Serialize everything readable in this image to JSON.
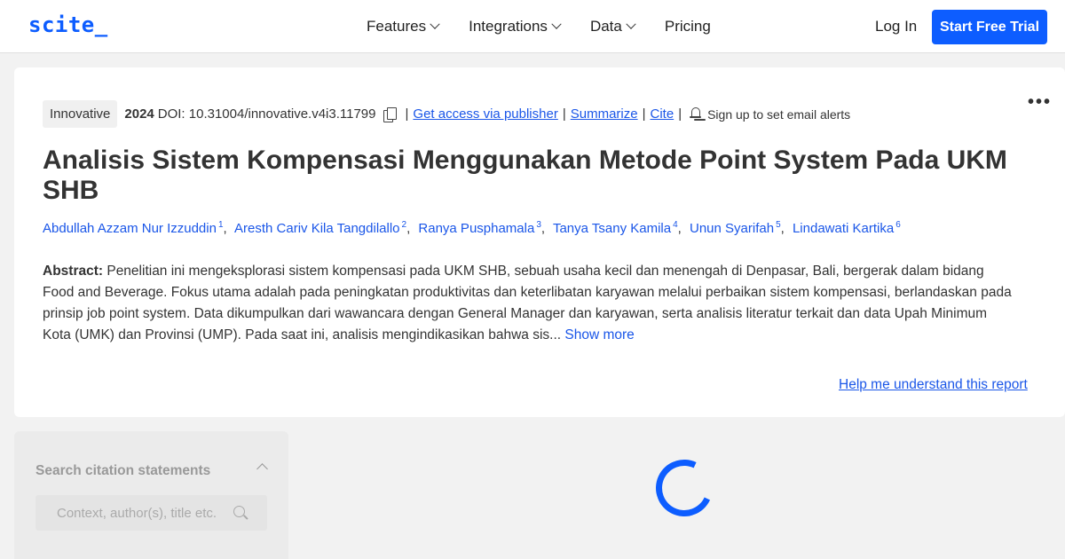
{
  "nav": {
    "logo": "scite_",
    "links": [
      "Features",
      "Integrations",
      "Data",
      "Pricing"
    ],
    "login": "Log In",
    "trial": "Start Free Trial"
  },
  "article": {
    "journal": "Innovative",
    "year": "2024",
    "doi": "DOI: 10.31004/innovative.v4i3.11799",
    "links": {
      "access": "Get access via publisher",
      "summarize": "Summarize",
      "cite": "Cite"
    },
    "alerts": "Sign up to set email alerts",
    "more_menu": "•••",
    "title": "Analisis Sistem Kompensasi Menggunakan Metode Point System Pada UKM SHB",
    "authors": [
      {
        "name": "Abdullah Azzam Nur Izzuddin",
        "num": "1"
      },
      {
        "name": "Aresth Cariv Kila Tangdilallo",
        "num": "2"
      },
      {
        "name": "Ranya Pusphamala",
        "num": "3"
      },
      {
        "name": "Tanya Tsany Kamila",
        "num": "4"
      },
      {
        "name": "Unun Syarifah",
        "num": "5"
      },
      {
        "name": "Lindawati Kartika",
        "num": "6"
      }
    ],
    "abstract_label": "Abstract:",
    "abstract_text": " Penelitian ini mengeksplorasi sistem kompensasi pada UKM SHB, sebuah usaha kecil dan menengah di Denpasar, Bali, bergerak dalam bidang Food and Beverage. Fokus utama adalah pada peningkatan produktivitas dan keterlibatan karyawan melalui perbaikan sistem kompensasi, berlandaskan pada prinsip job point system. Data dikumpulkan dari wawancara dengan General Manager dan karyawan, serta analisis literatur terkait dan data Upah Minimum Kota (UMK) dan Provinsi (UMP). Pada saat ini, analisis mengindikasikan bahwa sis... ",
    "show_more": "Show more",
    "help": "Help me understand this report"
  },
  "sidebar": {
    "title": "Search citation statements",
    "placeholder": "Context, author(s), title etc."
  },
  "colors": {
    "brand": "#0d5dff",
    "link": "#1a56e8"
  }
}
